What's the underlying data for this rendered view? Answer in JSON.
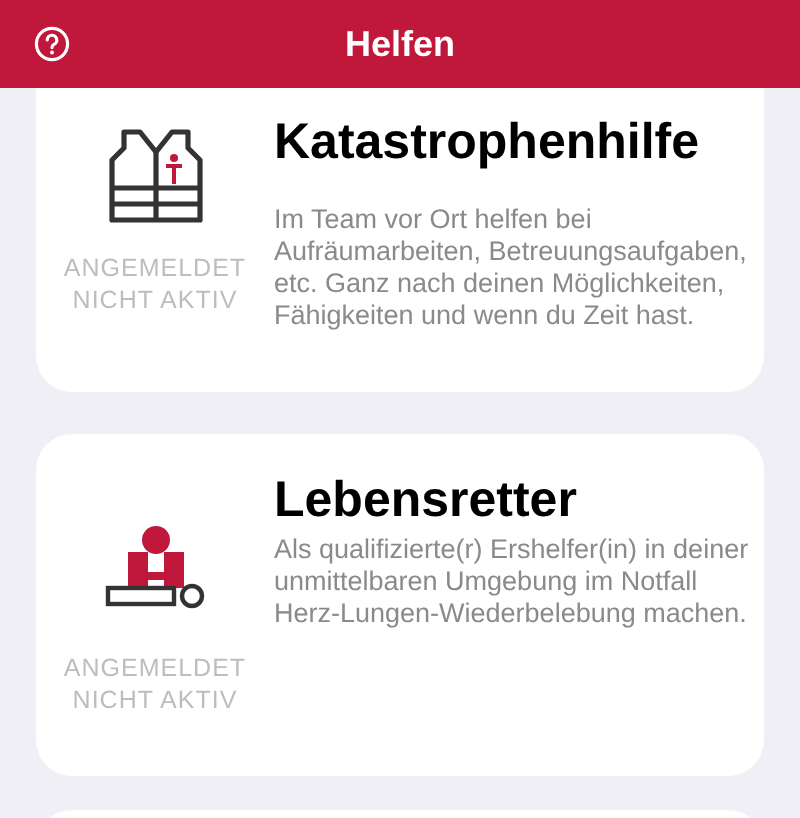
{
  "header": {
    "title": "Helfen"
  },
  "cards": [
    {
      "kind": "vest",
      "title": "Katastrophenhilfe",
      "status": [
        "ANGEMELDET",
        "NICHT AKTIV"
      ],
      "description": "Im Team vor Ort helfen bei Aufräumarbeiten, Betreuungsaufgaben, etc. Ganz nach deinen Möglichkeiten, Fähigkeiten und wenn du Zeit hast."
    },
    {
      "kind": "cpr",
      "title": "Lebensretter",
      "status": [
        "ANGEMELDET",
        "NICHT AKTIV"
      ],
      "description": "Als qualifizierte(r) Ershelfer(in) in deiner unmittelbaren Umgebung im Notfall Herz-Lungen-Wiederbelebung machen."
    }
  ]
}
